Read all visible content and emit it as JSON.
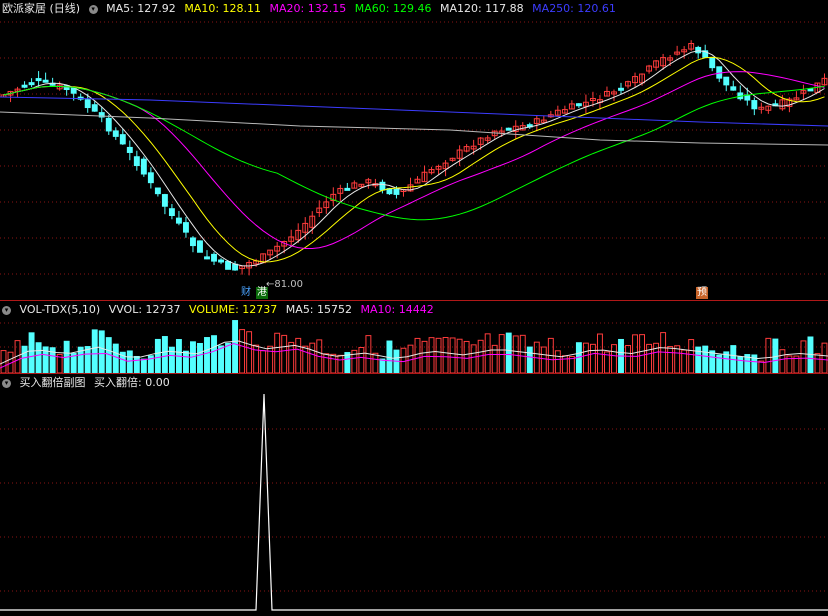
{
  "colors": {
    "up": "#ff3c3c",
    "down": "#54ffff",
    "grid": "#8a1515",
    "ma5": "#e8e8e8",
    "ma10": "#ffff00",
    "ma20": "#ff00ff",
    "ma60": "#00ff00",
    "ma120": "#b9b9b9",
    "ma250": "#3c3cff",
    "vol_ma5": "#e8e8e8",
    "vol_ma10": "#ff00ff",
    "signal": "#ffffff"
  },
  "price_panel": {
    "title": "欧派家居 (日线)",
    "indicators": [
      {
        "label": "MA5: 127.92",
        "color": "#e8e8e8"
      },
      {
        "label": "MA10: 128.11",
        "color": "#ffff00"
      },
      {
        "label": "MA20: 132.15",
        "color": "#ff00ff"
      },
      {
        "label": "MA60: 129.46",
        "color": "#00ff00"
      },
      {
        "label": "MA120: 117.88",
        "color": "#e8e8e8"
      },
      {
        "label": "MA250: 120.61",
        "color": "#3c3cff"
      }
    ],
    "low_label": "81.00",
    "badges": [
      {
        "text": "财",
        "bg": "#000000",
        "fg": "#4aa3ff"
      },
      {
        "text": "港",
        "bg": "#0a6b0a",
        "fg": "#ffffff"
      },
      {
        "text": "预",
        "bg": "#c8642a",
        "fg": "#ffffff"
      }
    ]
  },
  "volume_panel": {
    "title": "VOL-TDX(5,10)",
    "indicators": [
      {
        "label": "VVOL: 12737",
        "color": "#e8e8e8"
      },
      {
        "label": "VOLUME: 12737",
        "color": "#ffff00"
      },
      {
        "label": "MA5: 15752",
        "color": "#e8e8e8"
      },
      {
        "label": "MA10: 14442",
        "color": "#ff00ff"
      }
    ]
  },
  "signal_panel": {
    "title": "买入翻倍副图",
    "indicators": [
      {
        "label": "买入翻倍: 0.00",
        "color": "#e8e8e8"
      }
    ]
  }
}
